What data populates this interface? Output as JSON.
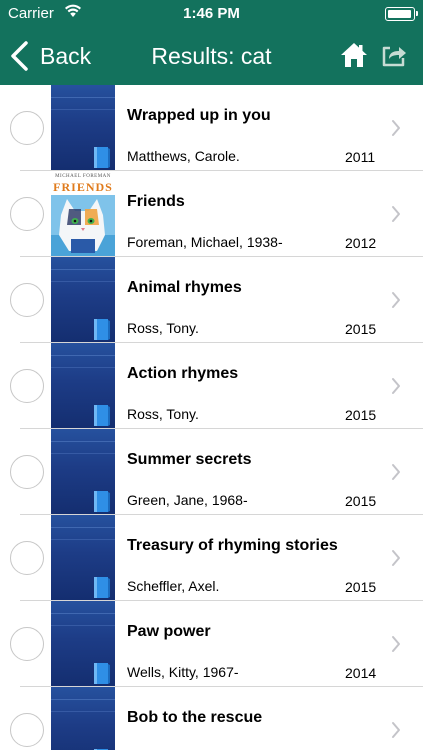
{
  "status_bar": {
    "carrier": "Carrier",
    "time": "1:46 PM",
    "wifi_icon": "wifi-icon",
    "battery_icon": "battery-icon",
    "battery_level": 1.0
  },
  "nav_bar": {
    "back_label": "Back",
    "title": "Results: cat",
    "home_icon": "home-icon",
    "share_icon": "share-icon",
    "background_color": "#13725d"
  },
  "results": [
    {
      "title": "Wrapped up in you",
      "author": "Matthews, Carole.",
      "year": "2011",
      "cover": "generic"
    },
    {
      "title": "Friends",
      "author": "Foreman, Michael, 1938-",
      "year": "2012",
      "cover": "friends",
      "cover_text_small": "MICHAEL FOREMAN",
      "cover_text_big": "FRIENDS"
    },
    {
      "title": "Animal rhymes",
      "author": "Ross, Tony.",
      "year": "2015",
      "cover": "generic"
    },
    {
      "title": "Action rhymes",
      "author": "Ross, Tony.",
      "year": "2015",
      "cover": "generic"
    },
    {
      "title": "Summer secrets",
      "author": "Green, Jane, 1968-",
      "year": "2015",
      "cover": "generic"
    },
    {
      "title": "Treasury of rhyming stories",
      "author": "Scheffler, Axel.",
      "year": "2015",
      "cover": "generic"
    },
    {
      "title": "Paw power",
      "author": "Wells, Kitty, 1967-",
      "year": "2014",
      "cover": "generic"
    },
    {
      "title": "Bob to the rescue",
      "author": "",
      "year": "",
      "cover": "generic"
    }
  ]
}
